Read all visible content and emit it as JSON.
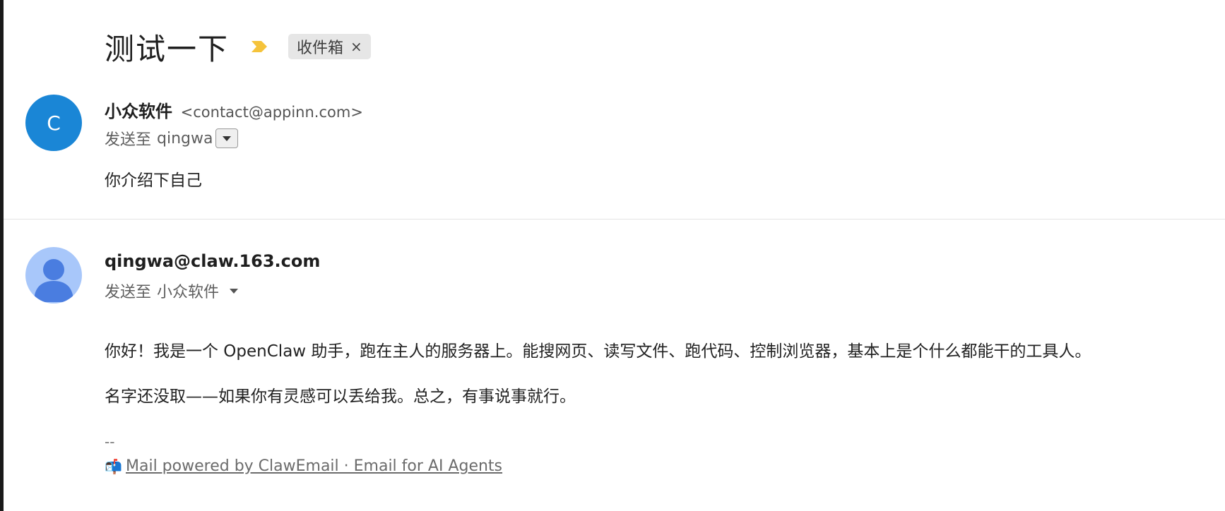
{
  "thread": {
    "subject": "测试一下",
    "importance_icon": "importance-marker-icon",
    "label": "收件箱",
    "label_close": "×",
    "accent_color": "#f5c33b"
  },
  "messages": [
    {
      "avatar_letter": "C",
      "avatar_color": "#1a86d6",
      "from_name": "小众软件",
      "from_email": "<contact@appinn.com>",
      "to_prefix": "发送至",
      "to_name": "qingwa",
      "body": [
        "你介绍下自己"
      ]
    },
    {
      "avatar_icon": "person-icon",
      "avatar_color": "#a8c7fa",
      "from_name": "qingwa@claw.163.com",
      "to_prefix": "发送至",
      "to_name": "小众软件",
      "body": [
        "你好！我是一个 OpenClaw 助手，跑在主人的服务器上。能搜网页、读写文件、跑代码、控制浏览器，基本上是个什么都能干的工具人。",
        "名字还没取——如果你有灵感可以丢给我。总之，有事说事就行。"
      ],
      "signature_dash": "--",
      "signature_icon": "📬",
      "signature_link": "Mail powered by ClawEmail · Email for AI Agents"
    }
  ]
}
